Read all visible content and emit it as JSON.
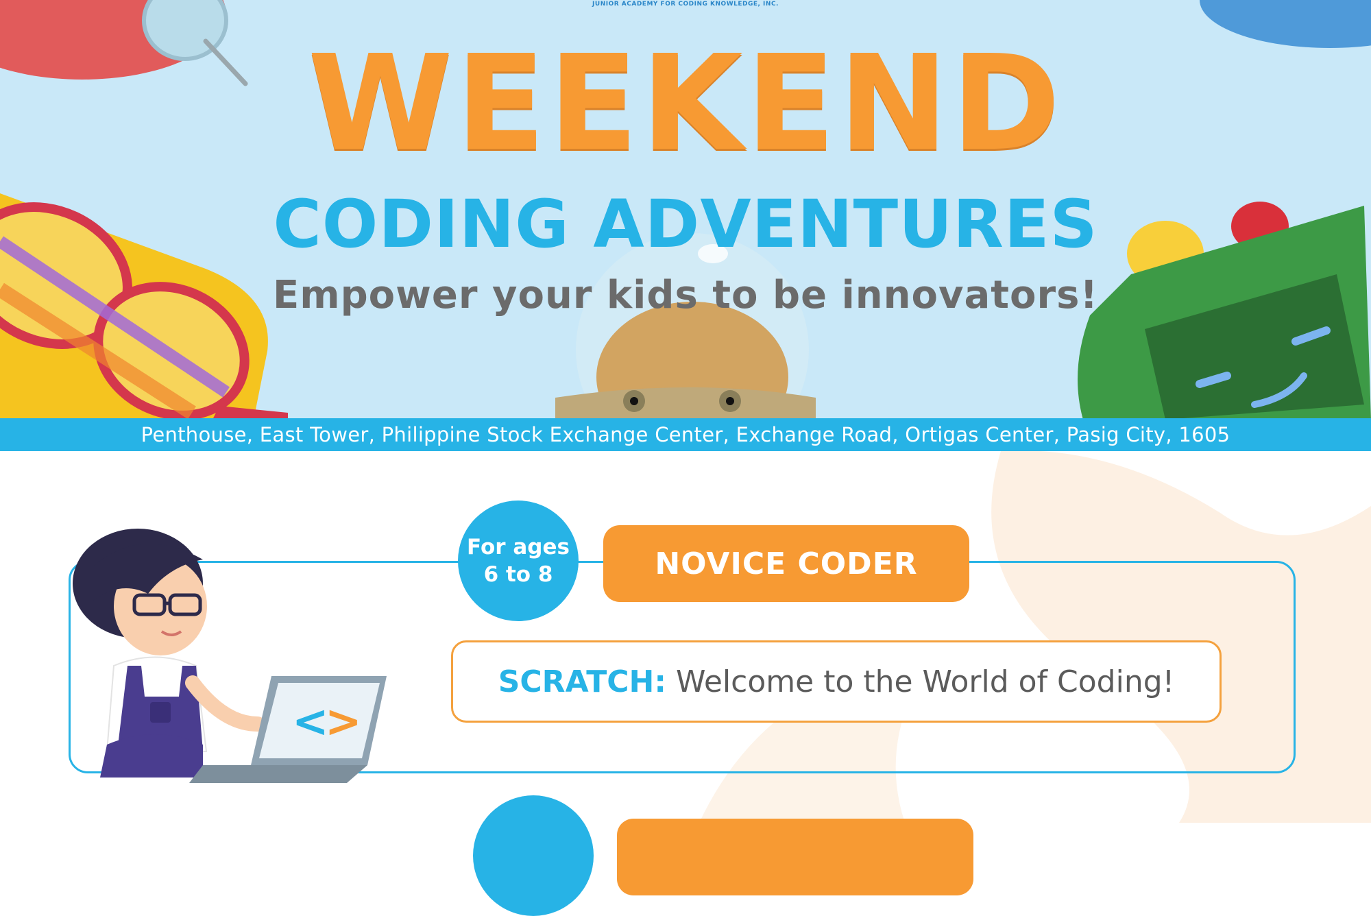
{
  "hero": {
    "org_name": "JUNIOR ACADEMY FOR CODING KNOWLEDGE, INC.",
    "title": "WEEKEND",
    "subtitle": "CODING ADVENTURES",
    "tagline": "Empower your kids to be innovators!",
    "address": "Penthouse, East Tower, Philippine Stock Exchange Center, Exchange Road, Ortigas Center, Pasig City, 1605"
  },
  "course": {
    "age_line1": "For ages",
    "age_line2": "6 to 8",
    "level": "NOVICE CODER",
    "language": "SCRATCH:",
    "description": "Welcome to the World of Coding!"
  },
  "colors": {
    "orange": "#f79a33",
    "blue": "#27b3e6",
    "sky": "#c9e8f8",
    "gray_text": "#6b6b6b"
  },
  "icons": [
    "magnifier-icon",
    "glasses-icon",
    "robot-icon",
    "astronaut-icon",
    "kid-with-laptop-icon",
    "code-brackets-icon"
  ]
}
